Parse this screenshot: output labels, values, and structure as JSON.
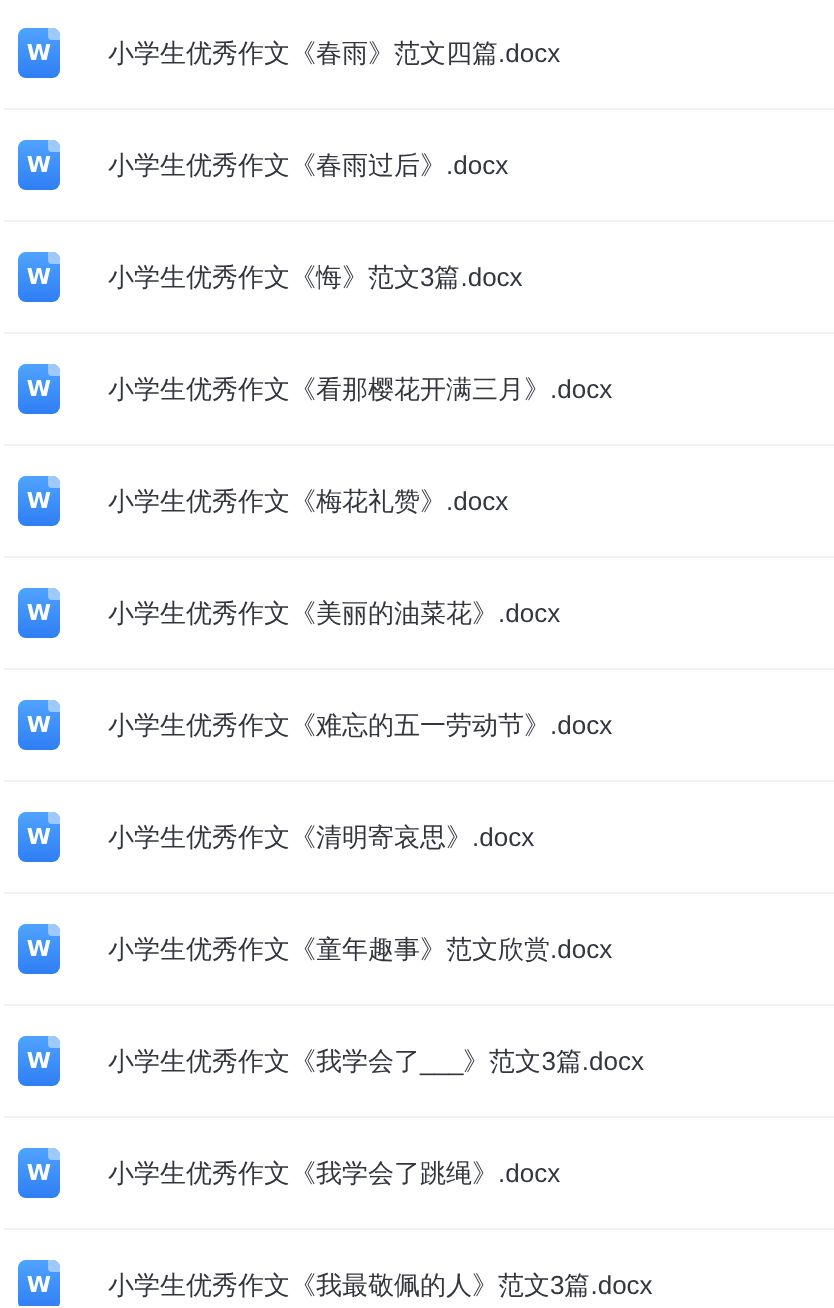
{
  "files": [
    {
      "icon_letter": "W",
      "name": "小学生优秀作文《春雨》范文四篇.docx"
    },
    {
      "icon_letter": "W",
      "name": "小学生优秀作文《春雨过后》.docx"
    },
    {
      "icon_letter": "W",
      "name": "小学生优秀作文《悔》范文3篇.docx"
    },
    {
      "icon_letter": "W",
      "name": "小学生优秀作文《看那樱花开满三月》.docx"
    },
    {
      "icon_letter": "W",
      "name": "小学生优秀作文《梅花礼赞》.docx"
    },
    {
      "icon_letter": "W",
      "name": "小学生优秀作文《美丽的油菜花》.docx"
    },
    {
      "icon_letter": "W",
      "name": "小学生优秀作文《难忘的五一劳动节》.docx"
    },
    {
      "icon_letter": "W",
      "name": "小学生优秀作文《清明寄哀思》.docx"
    },
    {
      "icon_letter": "W",
      "name": "小学生优秀作文《童年趣事》范文欣赏.docx"
    },
    {
      "icon_letter": "W",
      "name": "小学生优秀作文《我学会了___》范文3篇.docx"
    },
    {
      "icon_letter": "W",
      "name": "小学生优秀作文《我学会了跳绳》.docx"
    },
    {
      "icon_letter": "W",
      "name": "小学生优秀作文《我最敬佩的人》范文3篇.docx"
    }
  ]
}
